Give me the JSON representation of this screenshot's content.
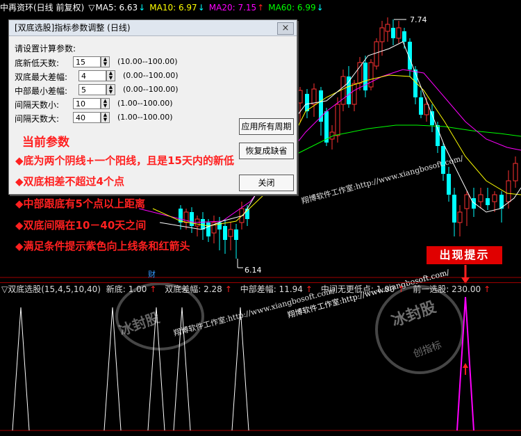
{
  "header": {
    "stock_name": "中再资环(日线 前复权)",
    "ma": [
      {
        "label": "MA5: 6.63",
        "color": "#ffffff"
      },
      {
        "label": "MA10: 6.97",
        "color": "#ffff00"
      },
      {
        "label": "MA20: 7.15",
        "color": "#ff00ff"
      },
      {
        "label": "MA60: 6.99",
        "color": "#00ff00"
      }
    ],
    "arrow_up": "↑",
    "arrow_down": "↓",
    "menu_glyph": "▽"
  },
  "main_chart": {
    "high_label": "7.74",
    "low_label": "6.14",
    "marker": "财"
  },
  "dialog": {
    "title": "[双底选股]指标参数调整 (日线)",
    "close_glyph": "×",
    "subtitle": "请设置计算参数:",
    "params": [
      {
        "label": "底新低天数:",
        "value": "15",
        "range": "(10.00--100.00)"
      },
      {
        "label": "双底最大差幅:",
        "value": "4",
        "range": "(0.00--100.00)"
      },
      {
        "label": "中部最小差幅:",
        "value": "5",
        "range": "(0.00--100.00)"
      },
      {
        "label": "间隔天数小:",
        "value": "10",
        "range": "(1.00--100.00)"
      },
      {
        "label": "间隔天数大:",
        "value": "40",
        "range": "(1.00--100.00)"
      }
    ],
    "buttons": {
      "apply_all": "应用所有周期",
      "restore": "恢复成缺省",
      "close": "关闭"
    }
  },
  "notes": {
    "title": "当前参数",
    "bullets": [
      "◆底为两个阴线+一个阳线，且是15天内的新低",
      "◆双底相差不超过4个点",
      "◆中部跟底有5个点以上距离",
      "◆双底间隔在10－40天之间",
      "◆满足条件提示紫色向上线条和红箭头"
    ]
  },
  "watermarks": {
    "url_text": "翔博软件工作室:http://www.xiangbosoft.com/",
    "seal_text": "冰封股",
    "seal_sub": "创指标"
  },
  "callout": "出现提示",
  "indicator": {
    "title": "▽双底选股(15,4,5,10,40)",
    "items": [
      {
        "label": "新底: 1.00",
        "arrow": "↑"
      },
      {
        "label": "双底差幅: 2.28",
        "arrow": "↑"
      },
      {
        "label": "中部差幅: 11.94",
        "arrow": "↑"
      },
      {
        "label": "中间无更低点: 1.00",
        "arrow": "↑"
      },
      {
        "label": "前一选股: 230.00",
        "arrow": "↑"
      }
    ]
  },
  "colors": {
    "up_candle": "#ff3232",
    "down_candle": "#00ffff",
    "ma5": "#ffffff",
    "ma10": "#ffff00",
    "ma20": "#ff00ff",
    "ma60": "#00ff00",
    "signal": "#ff00ff",
    "grid": "#a00000",
    "note_title": "#ff2020",
    "note_text": "#ffffff"
  }
}
